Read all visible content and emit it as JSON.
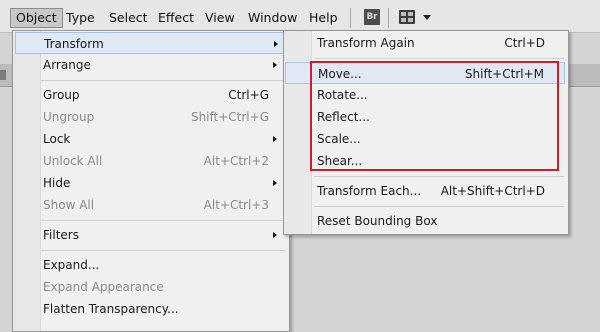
{
  "menubar": {
    "items": [
      {
        "label": "Object",
        "active": true
      },
      {
        "label": "Type"
      },
      {
        "label": "Select"
      },
      {
        "label": "Effect"
      },
      {
        "label": "View"
      },
      {
        "label": "Window"
      },
      {
        "label": "Help"
      }
    ],
    "bridge_label": "Br",
    "icons": [
      "bridge-icon",
      "arrange-documents-icon",
      "caret-down-icon"
    ]
  },
  "object_menu": {
    "items": [
      {
        "label": "Transform",
        "submenu": true,
        "highlighted": true
      },
      {
        "label": "Arrange",
        "submenu": true
      },
      {
        "label": "Group",
        "shortcut": "Ctrl+G"
      },
      {
        "label": "Ungroup",
        "shortcut": "Shift+Ctrl+G",
        "disabled": true
      },
      {
        "label": "Lock",
        "submenu": true
      },
      {
        "label": "Unlock All",
        "shortcut": "Alt+Ctrl+2",
        "disabled": true
      },
      {
        "label": "Hide",
        "submenu": true
      },
      {
        "label": "Show All",
        "shortcut": "Alt+Ctrl+3",
        "disabled": true
      },
      {
        "label": "Filters",
        "submenu": true
      },
      {
        "label": "Expand..."
      },
      {
        "label": "Expand Appearance",
        "disabled": true
      },
      {
        "label": "Flatten Transparency..."
      }
    ]
  },
  "transform_menu": {
    "items": [
      {
        "label": "Transform Again",
        "shortcut": "Ctrl+D"
      },
      {
        "label": "Move...",
        "shortcut": "Shift+Ctrl+M",
        "highlighted": true
      },
      {
        "label": "Rotate..."
      },
      {
        "label": "Reflect..."
      },
      {
        "label": "Scale..."
      },
      {
        "label": "Shear..."
      },
      {
        "label": "Transform Each...",
        "shortcut": "Alt+Shift+Ctrl+D"
      },
      {
        "label": "Reset Bounding Box"
      }
    ]
  },
  "annotation": {
    "highlight_color": "#cc1f2a"
  }
}
